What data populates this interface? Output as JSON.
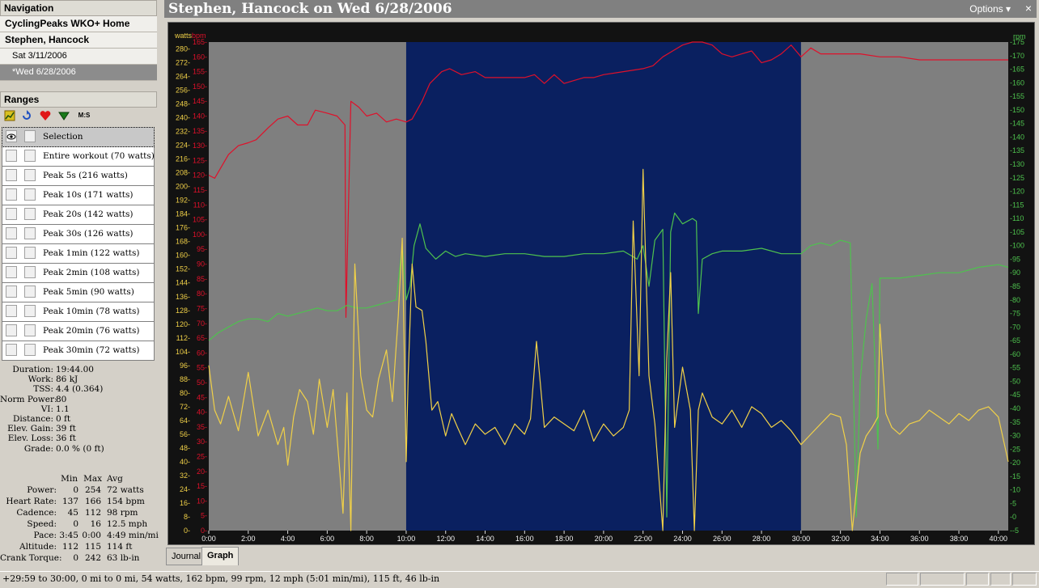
{
  "navigation": {
    "header": "Navigation",
    "items": [
      {
        "label": "CyclingPeaks WKO+ Home"
      },
      {
        "label": "Stephen, Hancock"
      },
      {
        "label": "Sat 3/11/2006"
      },
      {
        "label": "*Wed 6/28/2006"
      }
    ]
  },
  "ranges": {
    "header": "Ranges",
    "toolbar_ms": "M:S",
    "items": [
      {
        "label": "Selection"
      },
      {
        "label": "Entire workout (70 watts)"
      },
      {
        "label": "Peak 5s (216 watts)"
      },
      {
        "label": "Peak 10s (171 watts)"
      },
      {
        "label": "Peak 20s (142 watts)"
      },
      {
        "label": "Peak 30s (126 watts)"
      },
      {
        "label": "Peak 1min (122 watts)"
      },
      {
        "label": "Peak 2min (108 watts)"
      },
      {
        "label": "Peak 5min (90 watts)"
      },
      {
        "label": "Peak 10min (78 watts)"
      },
      {
        "label": "Peak 20min (76 watts)"
      },
      {
        "label": "Peak 30min (72 watts)"
      }
    ]
  },
  "summary": [
    {
      "label": "Duration:",
      "value": "19:44.00"
    },
    {
      "label": "Work:",
      "value": "86 kJ"
    },
    {
      "label": "TSS:",
      "value": "4.4 (0.364)"
    },
    {
      "label": "Norm Power:",
      "value": "80"
    },
    {
      "label": "VI:",
      "value": "1.1"
    },
    {
      "label": "Distance:",
      "value": "0 ft"
    },
    {
      "label": "Elev. Gain:",
      "value": "39 ft"
    },
    {
      "label": "Elev. Loss:",
      "value": "36 ft"
    },
    {
      "label": "Grade:",
      "value": "0.0 %  (0 ft)"
    }
  ],
  "stats": {
    "headers": {
      "min": "Min",
      "max": "Max",
      "avg": "Avg"
    },
    "rows": [
      {
        "label": "Power:",
        "min": "0",
        "max": "254",
        "avg": "72 watts"
      },
      {
        "label": "Heart Rate:",
        "min": "137",
        "max": "166",
        "avg": "154 bpm"
      },
      {
        "label": "Cadence:",
        "min": "45",
        "max": "112",
        "avg": "98 rpm"
      },
      {
        "label": "Speed:",
        "min": "0",
        "max": "16",
        "avg": "12.5 mph"
      },
      {
        "label": "Pace:",
        "min": "3:45",
        "max": "0:00",
        "avg": "4:49 min/mi"
      },
      {
        "label": "Altitude:",
        "min": "112",
        "max": "115",
        "avg": "114 ft"
      },
      {
        "label": "Crank Torque:",
        "min": "0",
        "max": "242",
        "avg": "63 lb-in"
      }
    ]
  },
  "window": {
    "title": "Stephen, Hancock on Wed 6/28/2006",
    "options_label": "Options",
    "close_glyph": "×"
  },
  "tabs": [
    {
      "label": "Journal"
    },
    {
      "label": "Graph"
    }
  ],
  "status_bar": {
    "text": "+29:59 to 30:00, 0 mi to 0 mi, 54 watts, 162 bpm, 99 rpm, 12 mph (5:01 min/mi), 115 ft, 46 lb-in"
  },
  "colors": {
    "power": "#f0d048",
    "heart_rate": "#e0102a",
    "cadence": "#4ec24e",
    "selection_band": "#0a2060",
    "unselected_band": "#7f7f7f",
    "axis_bg": "#141414"
  },
  "chart_data": {
    "type": "line",
    "x_unit": "minutes",
    "x_ticks": [
      "0:00",
      "2:00",
      "4:00",
      "6:00",
      "8:00",
      "10:00",
      "12:00",
      "14:00",
      "16:00",
      "18:00",
      "20:00",
      "22:00",
      "24:00",
      "26:00",
      "28:00",
      "30:00",
      "32:00",
      "34:00",
      "36:00",
      "38:00",
      "40:00"
    ],
    "xlim": [
      0,
      40.5
    ],
    "selection": {
      "start": 10.0,
      "end": 30.0
    },
    "axes": {
      "watts": {
        "label": "watts",
        "ylim": [
          0,
          284
        ],
        "ticks": [
          0,
          8,
          16,
          24,
          32,
          40,
          48,
          56,
          64,
          72,
          80,
          88,
          96,
          104,
          112,
          120,
          128,
          136,
          144,
          152,
          160,
          168,
          176,
          184,
          192,
          200,
          208,
          216,
          224,
          232,
          240,
          248,
          256,
          264,
          272,
          280
        ]
      },
      "bpm": {
        "label": "bpm",
        "ylim": [
          0,
          165
        ],
        "ticks": [
          0,
          5,
          10,
          15,
          20,
          25,
          30,
          35,
          40,
          45,
          50,
          55,
          60,
          65,
          70,
          75,
          80,
          85,
          90,
          95,
          100,
          105,
          110,
          115,
          120,
          125,
          130,
          135,
          140,
          145,
          150,
          155,
          160,
          165
        ]
      },
      "rpm": {
        "label": "rpm",
        "ylim": [
          -5,
          175
        ],
        "ticks": [
          -5,
          0,
          5,
          10,
          15,
          20,
          25,
          30,
          35,
          40,
          45,
          50,
          55,
          60,
          65,
          70,
          75,
          80,
          85,
          90,
          95,
          100,
          105,
          110,
          115,
          120,
          125,
          130,
          135,
          140,
          145,
          150,
          155,
          160,
          165,
          170,
          175
        ]
      }
    },
    "series": [
      {
        "name": "heart rate",
        "axis": "bpm",
        "color": "#e0102a",
        "x": [
          0,
          0.3,
          1.0,
          1.5,
          2.0,
          2.4,
          3.0,
          3.5,
          4.0,
          4.5,
          5.0,
          5.4,
          6.0,
          6.5,
          6.9,
          6.95,
          7.2,
          7.6,
          8.0,
          8.5,
          9.0,
          9.5,
          10.0,
          10.3,
          10.8,
          11.2,
          11.8,
          12.2,
          12.8,
          13.5,
          14.0,
          15.0,
          16.0,
          16.5,
          17.0,
          17.5,
          18.0,
          18.5,
          19.0,
          19.5,
          20.0,
          21.0,
          22.0,
          22.5,
          23.0,
          23.5,
          24.0,
          24.5,
          25.0,
          25.5,
          26.0,
          26.5,
          27.0,
          27.5,
          28.0,
          28.5,
          29.0,
          29.5,
          30.0,
          30.5,
          31.0,
          32.0,
          33.0,
          34.0,
          35.0,
          36.0,
          37.0,
          38.0,
          39.0,
          40.0,
          40.5
        ],
        "values": [
          120,
          119,
          127,
          130,
          131,
          132,
          136,
          139,
          140,
          137,
          137,
          142,
          141,
          140,
          137,
          72,
          145,
          143,
          140,
          141,
          138,
          139,
          138,
          139,
          145,
          151,
          155,
          156,
          154,
          155,
          153,
          153,
          153,
          154,
          151,
          154,
          151,
          152,
          153,
          153,
          154,
          155,
          156,
          157,
          160,
          162,
          164,
          165,
          165,
          164,
          161,
          160,
          161,
          162,
          158,
          159,
          161,
          164,
          160,
          163,
          161,
          161,
          161,
          160,
          160,
          159,
          159,
          159,
          159,
          159,
          159
        ]
      },
      {
        "name": "cadence",
        "axis": "rpm",
        "color": "#4ec24e",
        "x": [
          0,
          0.5,
          1.0,
          1.5,
          2.0,
          2.5,
          3.0,
          3.5,
          4.0,
          4.5,
          5.0,
          5.5,
          6.0,
          6.5,
          7.0,
          7.5,
          8.0,
          8.5,
          9.0,
          9.5,
          9.8,
          10.0,
          10.2,
          10.4,
          10.7,
          11.0,
          11.5,
          12.0,
          12.5,
          13.0,
          14.0,
          15.0,
          16.0,
          17.0,
          18.0,
          19.0,
          20.0,
          21.0,
          21.7,
          22.0,
          22.3,
          22.6,
          23.0,
          23.2,
          23.4,
          23.6,
          24.0,
          24.5,
          24.7,
          24.8,
          25.0,
          25.5,
          26.0,
          27.0,
          28.0,
          29.0,
          30.0,
          30.5,
          31.0,
          31.5,
          32.0,
          32.5,
          32.8,
          33.0,
          33.3,
          33.6,
          33.9,
          34.0,
          34.5,
          35.0,
          36.0,
          37.0,
          38.0,
          39.0,
          40.0,
          40.5
        ],
        "values": [
          65,
          68,
          70,
          72,
          73,
          73,
          72,
          75,
          74,
          75,
          76,
          77,
          76,
          76,
          78,
          77,
          77,
          78,
          79,
          80,
          100,
          80,
          85,
          100,
          108,
          99,
          95,
          98,
          96,
          97,
          96,
          97,
          97,
          96,
          96,
          97,
          97,
          98,
          95,
          100,
          85,
          102,
          106,
          0,
          105,
          112,
          108,
          110,
          109,
          75,
          95,
          97,
          98,
          98,
          99,
          97,
          97,
          100,
          101,
          100,
          102,
          101,
          0,
          50,
          73,
          86,
          25,
          88,
          88,
          88,
          89,
          90,
          90,
          92,
          93,
          92
        ]
      },
      {
        "name": "power",
        "axis": "watts",
        "color": "#f0d048",
        "x": [
          0,
          0.3,
          0.6,
          1.0,
          1.5,
          2.0,
          2.5,
          3.0,
          3.5,
          3.8,
          4.0,
          4.3,
          4.6,
          5.0,
          5.3,
          5.6,
          6.0,
          6.3,
          6.6,
          6.8,
          7.0,
          7.2,
          7.4,
          7.7,
          8.0,
          8.3,
          8.6,
          9.0,
          9.3,
          9.6,
          9.8,
          10.0,
          10.1,
          10.3,
          10.5,
          10.8,
          11.0,
          11.3,
          11.6,
          12.0,
          12.3,
          12.6,
          13.0,
          13.5,
          14.0,
          14.5,
          15.0,
          15.5,
          16.0,
          16.3,
          16.6,
          17.0,
          17.5,
          18.0,
          18.5,
          19.0,
          19.5,
          20.0,
          20.5,
          21.0,
          21.3,
          21.5,
          21.8,
          22.0,
          22.3,
          22.6,
          23.0,
          23.2,
          23.4,
          23.6,
          24.0,
          24.4,
          24.6,
          24.8,
          25.0,
          25.5,
          26.0,
          26.5,
          27.0,
          27.5,
          28.0,
          28.5,
          29.0,
          29.5,
          30.0,
          30.5,
          31.0,
          31.5,
          32.0,
          32.3,
          32.6,
          33.0,
          33.3,
          33.6,
          33.9,
          34.0,
          34.3,
          34.6,
          35.0,
          35.5,
          36.0,
          36.5,
          37.0,
          37.5,
          38.0,
          38.5,
          39.0,
          39.5,
          40.0,
          40.5
        ],
        "values": [
          96,
          70,
          62,
          78,
          58,
          92,
          55,
          70,
          50,
          60,
          38,
          66,
          82,
          75,
          56,
          88,
          60,
          82,
          40,
          10,
          80,
          0,
          155,
          90,
          70,
          66,
          88,
          105,
          75,
          125,
          170,
          40,
          90,
          155,
          130,
          128,
          110,
          70,
          75,
          55,
          68,
          60,
          50,
          62,
          56,
          60,
          50,
          62,
          56,
          65,
          110,
          60,
          66,
          62,
          58,
          70,
          52,
          62,
          55,
          60,
          70,
          180,
          90,
          210,
          90,
          62,
          0,
          100,
          150,
          60,
          95,
          70,
          0,
          70,
          80,
          66,
          62,
          70,
          60,
          72,
          68,
          60,
          64,
          58,
          50,
          56,
          62,
          68,
          66,
          50,
          0,
          45,
          55,
          60,
          66,
          120,
          68,
          60,
          56,
          62,
          64,
          70,
          66,
          62,
          68,
          64,
          70,
          72,
          66,
          40
        ]
      }
    ]
  }
}
